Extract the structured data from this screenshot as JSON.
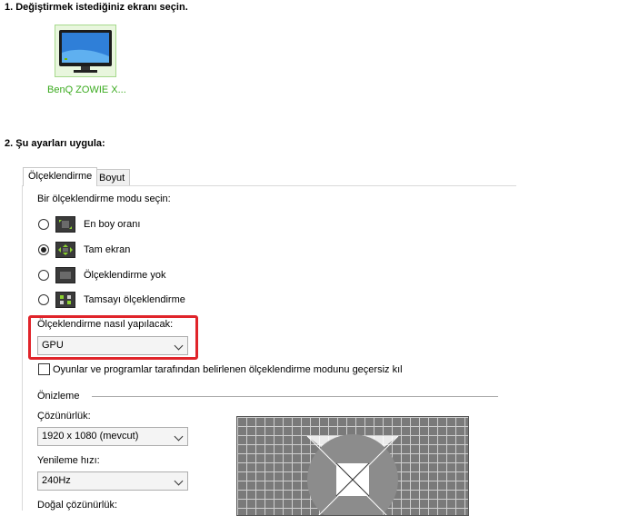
{
  "step1": {
    "title": "1. Değiştirmek istediğiniz ekranı seçin."
  },
  "display": {
    "name": "BenQ ZOWIE X..."
  },
  "step2": {
    "title": "2. Şu ayarları uygula:"
  },
  "tabs": [
    {
      "label": "Ölçeklendirme",
      "active": true
    },
    {
      "label": "Boyut",
      "active": false
    }
  ],
  "scaling_mode": {
    "prompt": "Bir ölçeklendirme modu seçin:",
    "options": [
      {
        "label": "En boy oranı",
        "selected": false
      },
      {
        "label": "Tam ekran",
        "selected": true
      },
      {
        "label": "Ölçeklendirme yok",
        "selected": false
      },
      {
        "label": "Tamsayı ölçeklendirme",
        "selected": false
      }
    ]
  },
  "perform_scaling": {
    "label": "Ölçeklendirme nasıl yapılacak:",
    "value": "GPU"
  },
  "override": {
    "label": "Oyunlar ve programlar tarafından belirlenen ölçeklendirme modunu geçersiz kıl",
    "checked": false
  },
  "preview": {
    "title": "Önizleme",
    "resolution_label": "Çözünürlük:",
    "resolution_value": "1920 x 1080 (mevcut)",
    "refresh_label": "Yenileme hızı:",
    "refresh_value": "240Hz",
    "native_label": "Doğal çözünürlük:"
  },
  "colors": {
    "accent_green": "#76b900",
    "highlight_red": "#e0242a"
  }
}
